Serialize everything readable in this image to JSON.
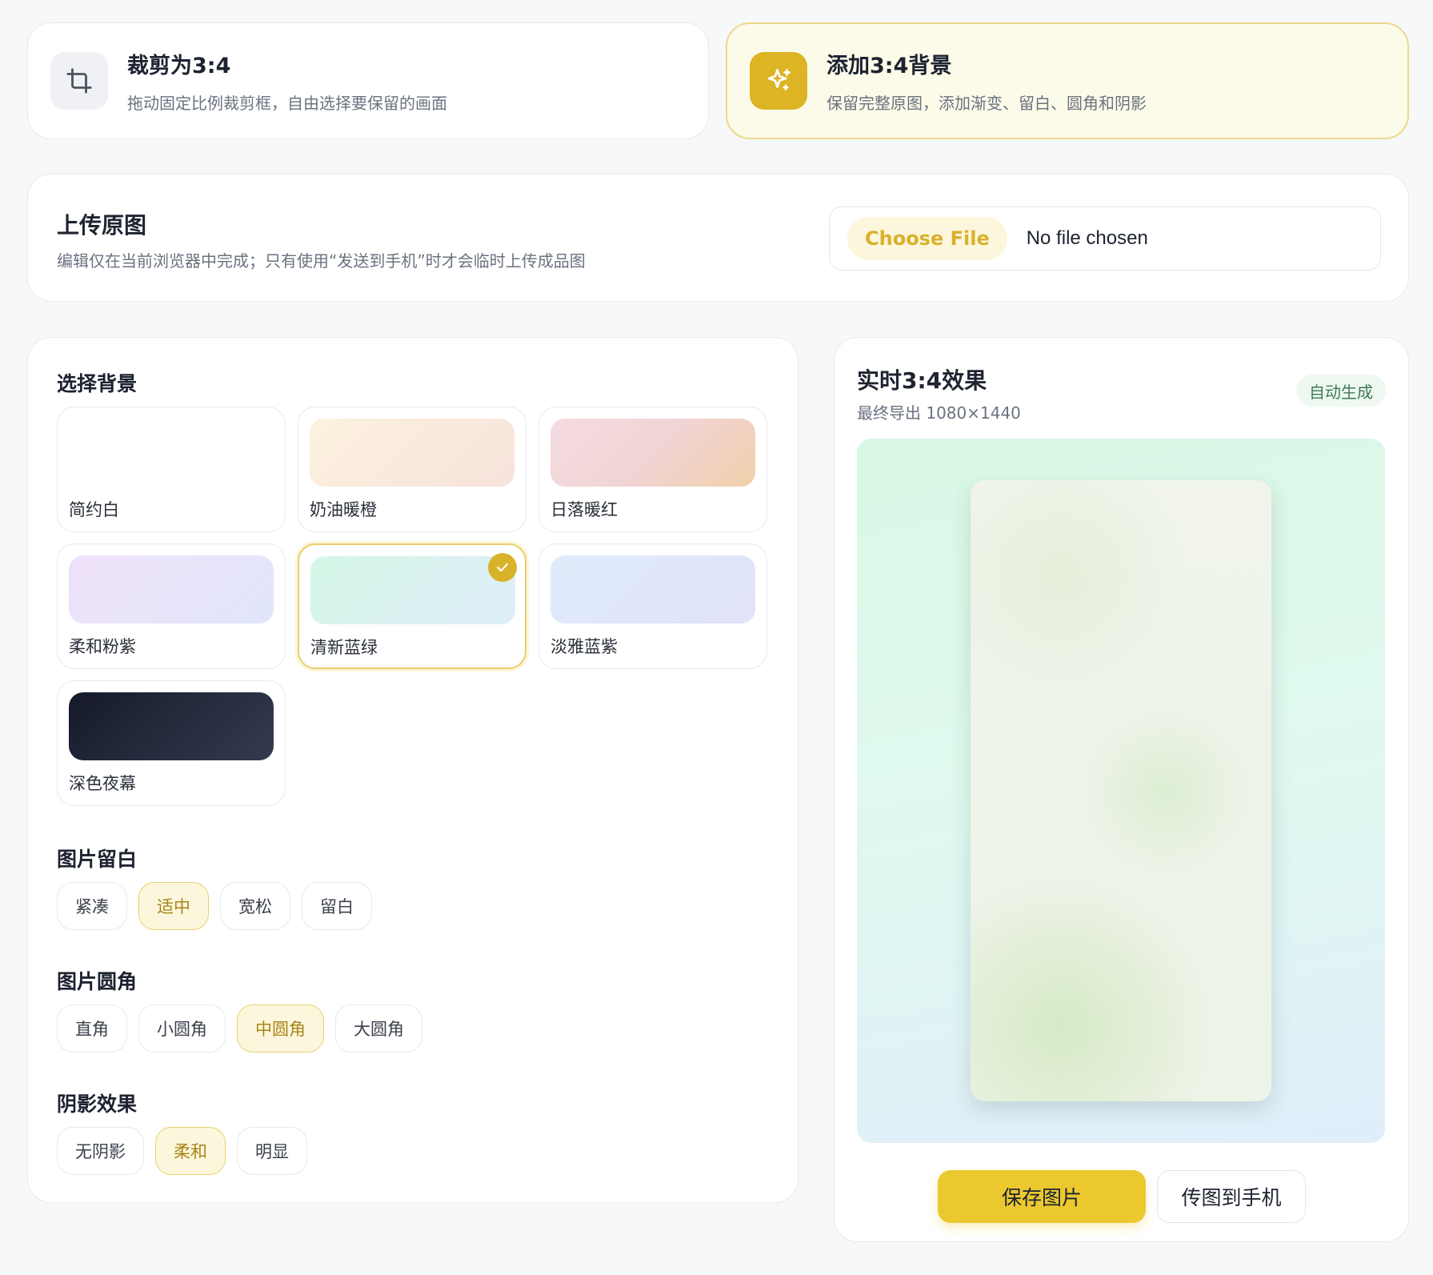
{
  "modes": [
    {
      "title": "裁剪为3:4",
      "desc": "拖动固定比例裁剪框，自由选择要保留的画面",
      "icon": "crop-icon"
    },
    {
      "title": "添加3:4背景",
      "desc": "保留完整原图，添加渐变、留白、圆角和阴影",
      "icon": "sparkle-icon"
    }
  ],
  "upload": {
    "title": "上传原图",
    "desc": "编辑仅在当前浏览器中完成；只有使用“发送到手机”时才会临时上传成品图",
    "choose_label": "Choose File",
    "status": "No file chosen"
  },
  "background": {
    "title": "选择背景",
    "options": [
      {
        "label": "简约白",
        "from": "#ffffff",
        "to": "#ffffff"
      },
      {
        "label": "奶油暖橙",
        "from": "#fcf1de",
        "to": "#f7e3dc"
      },
      {
        "label": "日落暖红",
        "from": "#f4dbe1",
        "to": "#f1d0aa"
      },
      {
        "label": "柔和粉紫",
        "from": "#efe2fa",
        "to": "#e1e6fb"
      },
      {
        "label": "清新蓝绿",
        "from": "#d5f7e6",
        "to": "#dfeefa"
      },
      {
        "label": "淡雅蓝紫",
        "from": "#dfebfb",
        "to": "#e1e2fb"
      },
      {
        "label": "深色夜幕",
        "from": "#161a2b",
        "to": "#343b4f"
      }
    ],
    "selected": "清新蓝绿"
  },
  "padding": {
    "title": "图片留白",
    "options": [
      "紧凑",
      "适中",
      "宽松",
      "留白"
    ],
    "selected": "适中"
  },
  "radius": {
    "title": "图片圆角",
    "options": [
      "直角",
      "小圆角",
      "中圆角",
      "大圆角"
    ],
    "selected": "中圆角"
  },
  "shadow": {
    "title": "阴影效果",
    "options": [
      "无阴影",
      "柔和",
      "明显"
    ],
    "selected": "柔和"
  },
  "preview": {
    "title": "实时3:4效果",
    "sub": "最终导出 1080×1440",
    "badge": "自动生成",
    "save_label": "保存图片",
    "send_label": "传图到手机"
  },
  "colors": {
    "accent": "#dcb424",
    "accent_soft": "#fcf7dc",
    "primary_button": "#ebc92e"
  }
}
